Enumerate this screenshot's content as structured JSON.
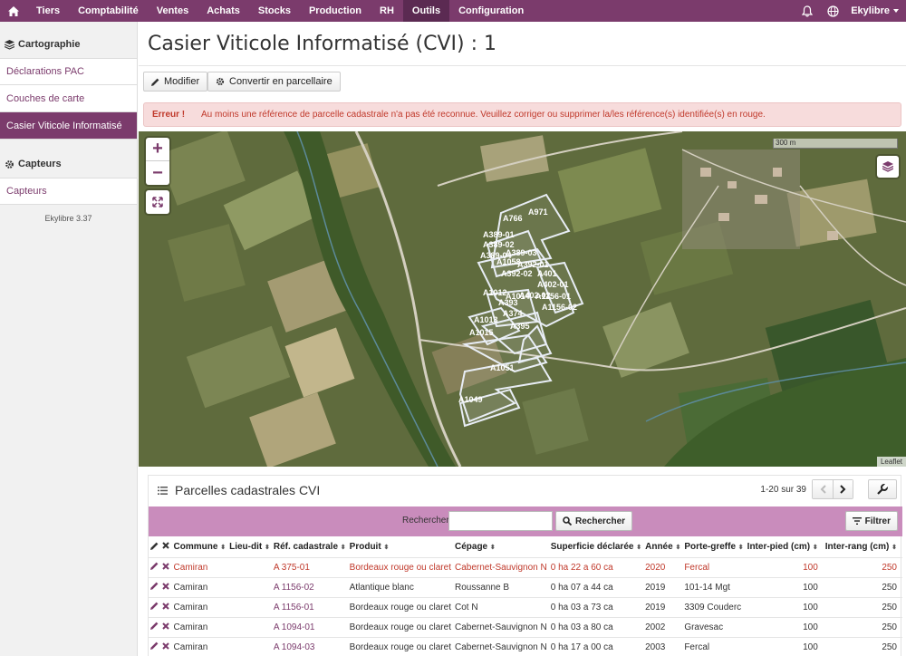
{
  "nav": {
    "items": [
      "Tiers",
      "Comptabilité",
      "Ventes",
      "Achats",
      "Stocks",
      "Production",
      "RH",
      "Outils",
      "Configuration"
    ],
    "active": "Outils",
    "user": "Ekylibre"
  },
  "sidebar": {
    "section1": "Cartographie",
    "items1": [
      "Déclarations PAC",
      "Couches de carte",
      "Casier Viticole Informatisé"
    ],
    "section2": "Capteurs",
    "items2": [
      "Capteurs"
    ],
    "version": "Ekylibre 3.37"
  },
  "page": {
    "title": "Casier Viticole Informatisé (CVI) : 1",
    "btn_edit": "Modifier",
    "btn_convert": "Convertir en parcellaire"
  },
  "alert": {
    "label": "Erreur !",
    "message": "Au moins une référence de parcelle cadastrale n'a pas été reconnue. Veuillez corriger ou supprimer la/les référence(s) identifiée(s) en rouge."
  },
  "map": {
    "scale": "300 m",
    "attribution": "Leaflet",
    "labels": [
      "A971",
      "A766",
      "A389-01",
      "A389-02",
      "A389-03",
      "A389-04",
      "A1058",
      "A392-01",
      "A392-02",
      "A401",
      "A402-01",
      "A402-02",
      "A1012",
      "A1014",
      "A393",
      "A1156-01",
      "A1156-02",
      "A374",
      "A1013",
      "A1015",
      "A395",
      "A1051",
      "A1049"
    ]
  },
  "panel": {
    "title": "Parcelles cadastrales CVI",
    "pager": "1-20 sur 39",
    "search_label": "Rechercher",
    "search_value": "",
    "search_btn": "Rechercher",
    "filter_btn": "Filtrer",
    "columns": [
      "Commune",
      "Lieu-dit",
      "Réf. cadastrale",
      "Produit",
      "Cépage",
      "Superficie déclarée",
      "Année",
      "Porte-greffe",
      "Inter-pied (cm)",
      "Inter-rang (cm)"
    ],
    "rows": [
      {
        "commune": "Camiran",
        "lieu": "",
        "ref": "A 375-01",
        "produit": "Bordeaux rouge ou claret",
        "cepage": "Cabernet-Sauvignon N",
        "surface": "0 ha 22 a 60 ca",
        "annee": "2020",
        "porte": "Fercal",
        "pied": "100",
        "rang": "250",
        "error": true
      },
      {
        "commune": "Camiran",
        "lieu": "",
        "ref": "A 1156-02",
        "produit": "Atlantique blanc",
        "cepage": "Roussanne B",
        "surface": "0 ha 07 a 44 ca",
        "annee": "2019",
        "porte": "101-14 Mgt",
        "pied": "100",
        "rang": "250",
        "error": false
      },
      {
        "commune": "Camiran",
        "lieu": "",
        "ref": "A 1156-01",
        "produit": "Bordeaux rouge ou claret",
        "cepage": "Cot N",
        "surface": "0 ha 03 a 73 ca",
        "annee": "2019",
        "porte": "3309 Couderc",
        "pied": "100",
        "rang": "250",
        "error": false
      },
      {
        "commune": "Camiran",
        "lieu": "",
        "ref": "A 1094-01",
        "produit": "Bordeaux rouge ou claret",
        "cepage": "Cabernet-Sauvignon N",
        "surface": "0 ha 03 a 80 ca",
        "annee": "2002",
        "porte": "Gravesac",
        "pied": "100",
        "rang": "250",
        "error": false
      },
      {
        "commune": "Camiran",
        "lieu": "",
        "ref": "A 1094-03",
        "produit": "Bordeaux rouge ou claret",
        "cepage": "Cabernet-Sauvignon N",
        "surface": "0 ha 17 a 00 ca",
        "annee": "2003",
        "porte": "Fercal",
        "pied": "100",
        "rang": "250",
        "error": false
      }
    ]
  }
}
